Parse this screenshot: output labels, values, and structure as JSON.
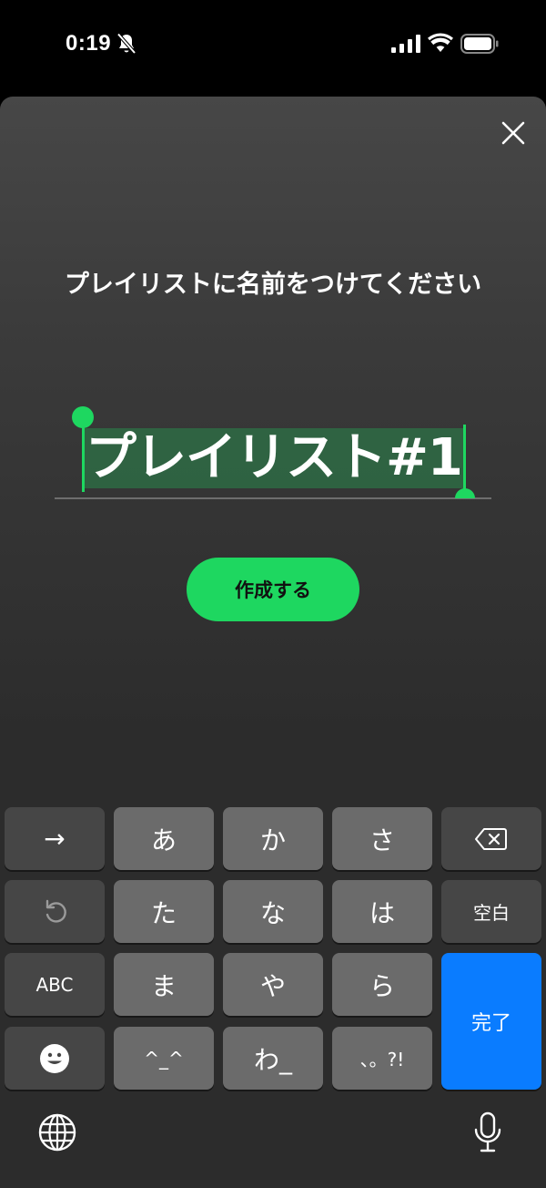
{
  "status_bar": {
    "time": "0:19",
    "icons": [
      "bell-slash-icon",
      "signal-icon",
      "wifi-icon",
      "battery-icon"
    ]
  },
  "dialog": {
    "title": "プレイリストに名前をつけてください",
    "input_value": "プレイリスト#1",
    "create_button": "作成する",
    "close_icon": "close-icon"
  },
  "keyboard": {
    "rows": [
      [
        "→",
        "あ",
        "か",
        "さ",
        "delete-icon"
      ],
      [
        "undo-icon",
        "た",
        "な",
        "は",
        "空白"
      ],
      [
        "ABC",
        "ま",
        "や",
        "ら",
        "完了"
      ],
      [
        "emoji-icon",
        "^_^",
        "わ_",
        "、。?!"
      ]
    ],
    "keys": {
      "arrow": "→",
      "a": "あ",
      "ka": "か",
      "sa": "さ",
      "ta": "た",
      "na": "な",
      "ha": "は",
      "space": "空白",
      "abc": "ABC",
      "ma": "ま",
      "ya": "や",
      "ra": "ら",
      "done": "完了",
      "kaomoji": "^_^",
      "wa": "わ_",
      "punct": "、。?!"
    },
    "bottom_icons": [
      "globe-icon",
      "mic-icon"
    ]
  },
  "colors": {
    "accent": "#1ed760",
    "selection": "#1ed760",
    "done_key": "#0a7cff",
    "key": "#6b6b6b",
    "key_dark": "#464646"
  }
}
